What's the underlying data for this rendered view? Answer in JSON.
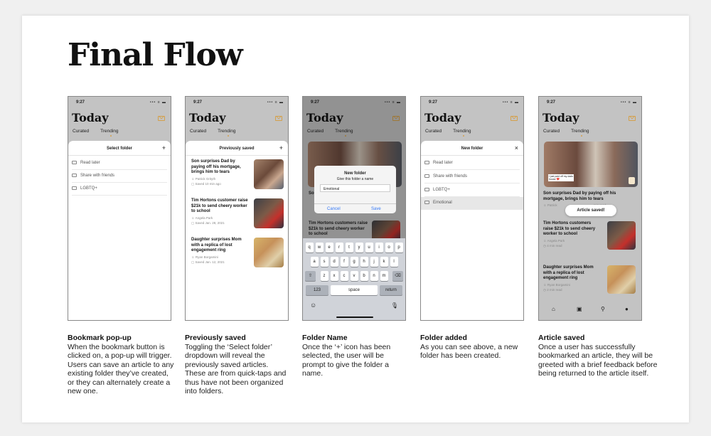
{
  "title": "Final Flow",
  "status": {
    "time": "9:27",
    "icons": "••• ≡ ▬"
  },
  "app": {
    "heading": "Today",
    "tabs": [
      "Curated",
      "Trending"
    ]
  },
  "screen1": {
    "sheet_title": "Select folder",
    "action": "+",
    "folders": [
      "Read later",
      "Share with friends",
      "LGBTQ+"
    ]
  },
  "screen2": {
    "sheet_title": "Previously saved",
    "action": "+",
    "articles": [
      {
        "title": "Son surprises Dad by paying off his mortgage, brings him to tears",
        "author": "Patrick Grityth",
        "saved": "Saved 10 min ago"
      },
      {
        "title": "Tim Hortons customer raise $21k to send cheery worker to school",
        "author": "Angela Park",
        "saved": "Saved Jan. 28, 2021"
      },
      {
        "title": "Daughter surprises Mom with a replica of lost engagement ring",
        "author": "Ryan Borgamini",
        "saved": "Saved Jan. 12, 2021"
      }
    ]
  },
  "screen3": {
    "dialog_title": "New folder",
    "dialog_sub": "Give this folder a name",
    "input": "Emotional",
    "cancel": "Cancel",
    "save": "Save",
    "article_title": "Tim Hortons customers raise $21k to send cheery worker to school",
    "peek": "Son",
    "kb_row1": [
      "q",
      "w",
      "e",
      "r",
      "t",
      "y",
      "u",
      "i",
      "o",
      "p"
    ],
    "kb_row2": [
      "a",
      "s",
      "d",
      "f",
      "g",
      "h",
      "j",
      "k",
      "l"
    ],
    "kb_row3": [
      "z",
      "x",
      "c",
      "v",
      "b",
      "n",
      "m"
    ],
    "kb_shift": "⇧",
    "kb_del": "⌫",
    "kb_123": "123",
    "kb_space": "space",
    "kb_return": "return",
    "kb_emoji": "☺",
    "kb_mic": "🎙"
  },
  "screen4": {
    "sheet_title": "New folder",
    "action": "×",
    "folders": [
      "Read later",
      "Share with friends",
      "LGBTQ+",
      "Emotional"
    ]
  },
  "screen5": {
    "toast": "Article saved!",
    "hero_caption": "I just paid off my dads house ❤️",
    "articles": [
      {
        "title": "Son surprises Dad by paying off his mortgage, brings him to tears",
        "author": "Patrick",
        "read": "min read"
      },
      {
        "title": "Tim Hortons customers raise $21k to send cheery worker to school",
        "author": "Angela Park",
        "read": "4 min read"
      },
      {
        "title": "Daughter surprises Mom with a replica of lost engagement ring",
        "author": "Ryan Borgamini",
        "read": "2 min read"
      }
    ],
    "nav": [
      "⌂",
      "▣",
      "⚲",
      "●"
    ]
  },
  "captions": [
    {
      "head": "Bookmark pop-up",
      "body": "When the bookmark button is clicked on, a pop-up will trigger. Users can save an article to any existing folder they’ve created, or they can alternately create a new one."
    },
    {
      "head": "Previously saved",
      "body": "Toggling the ‘Select folder’ dropdown will reveal the previously saved articles. These are from quick-taps and thus have not been organized into folders."
    },
    {
      "head": "Folder Name",
      "body": "Once the ‘+’ icon has been selected, the user will be prompt to give the folder a name."
    },
    {
      "head": "Folder added",
      "body": "As you can see above, a new folder has been created."
    },
    {
      "head": "Article saved",
      "body": "Once a user has successfully bookmarked an article, they will be greeted with a brief feedback before being returned to the article itself."
    }
  ]
}
